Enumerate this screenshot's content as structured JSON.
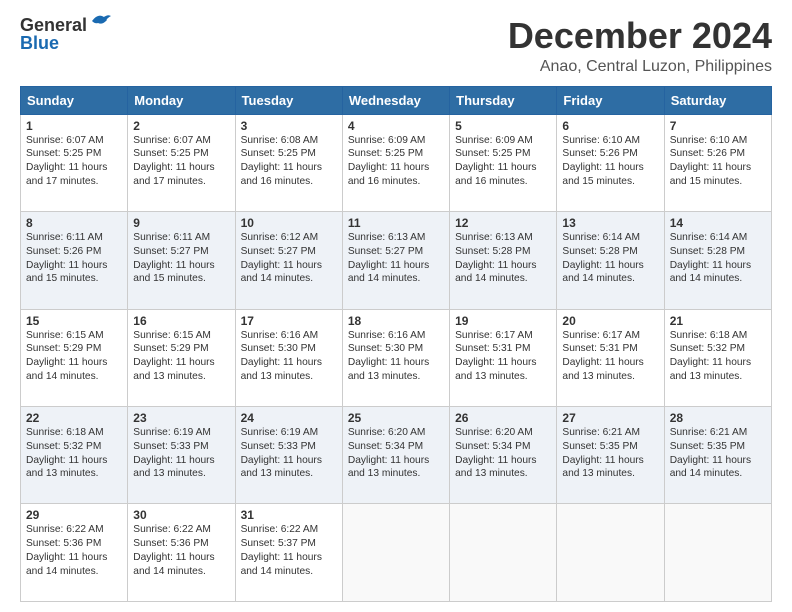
{
  "header": {
    "logo_general": "General",
    "logo_blue": "Blue",
    "title": "December 2024",
    "subtitle": "Anao, Central Luzon, Philippines"
  },
  "calendar": {
    "weekdays": [
      "Sunday",
      "Monday",
      "Tuesday",
      "Wednesday",
      "Thursday",
      "Friday",
      "Saturday"
    ],
    "weeks": [
      [
        null,
        null,
        null,
        null,
        {
          "day": 5,
          "sunrise": "6:09 AM",
          "sunset": "5:25 PM",
          "daylight": "11 hours and 16 minutes."
        },
        {
          "day": 6,
          "sunrise": "6:10 AM",
          "sunset": "5:26 PM",
          "daylight": "11 hours and 15 minutes."
        },
        {
          "day": 7,
          "sunrise": "6:10 AM",
          "sunset": "5:26 PM",
          "daylight": "11 hours and 15 minutes."
        }
      ],
      [
        {
          "day": 1,
          "sunrise": "6:07 AM",
          "sunset": "5:25 PM",
          "daylight": "11 hours and 17 minutes."
        },
        {
          "day": 2,
          "sunrise": "6:07 AM",
          "sunset": "5:25 PM",
          "daylight": "11 hours and 17 minutes."
        },
        {
          "day": 3,
          "sunrise": "6:08 AM",
          "sunset": "5:25 PM",
          "daylight": "11 hours and 16 minutes."
        },
        {
          "day": 4,
          "sunrise": "6:09 AM",
          "sunset": "5:25 PM",
          "daylight": "11 hours and 16 minutes."
        },
        {
          "day": 5,
          "sunrise": "6:09 AM",
          "sunset": "5:25 PM",
          "daylight": "11 hours and 16 minutes."
        },
        {
          "day": 6,
          "sunrise": "6:10 AM",
          "sunset": "5:26 PM",
          "daylight": "11 hours and 15 minutes."
        },
        {
          "day": 7,
          "sunrise": "6:10 AM",
          "sunset": "5:26 PM",
          "daylight": "11 hours and 15 minutes."
        }
      ],
      [
        {
          "day": 8,
          "sunrise": "6:11 AM",
          "sunset": "5:26 PM",
          "daylight": "11 hours and 15 minutes."
        },
        {
          "day": 9,
          "sunrise": "6:11 AM",
          "sunset": "5:27 PM",
          "daylight": "11 hours and 15 minutes."
        },
        {
          "day": 10,
          "sunrise": "6:12 AM",
          "sunset": "5:27 PM",
          "daylight": "11 hours and 14 minutes."
        },
        {
          "day": 11,
          "sunrise": "6:13 AM",
          "sunset": "5:27 PM",
          "daylight": "11 hours and 14 minutes."
        },
        {
          "day": 12,
          "sunrise": "6:13 AM",
          "sunset": "5:28 PM",
          "daylight": "11 hours and 14 minutes."
        },
        {
          "day": 13,
          "sunrise": "6:14 AM",
          "sunset": "5:28 PM",
          "daylight": "11 hours and 14 minutes."
        },
        {
          "day": 14,
          "sunrise": "6:14 AM",
          "sunset": "5:28 PM",
          "daylight": "11 hours and 14 minutes."
        }
      ],
      [
        {
          "day": 15,
          "sunrise": "6:15 AM",
          "sunset": "5:29 PM",
          "daylight": "11 hours and 14 minutes."
        },
        {
          "day": 16,
          "sunrise": "6:15 AM",
          "sunset": "5:29 PM",
          "daylight": "11 hours and 13 minutes."
        },
        {
          "day": 17,
          "sunrise": "6:16 AM",
          "sunset": "5:30 PM",
          "daylight": "11 hours and 13 minutes."
        },
        {
          "day": 18,
          "sunrise": "6:16 AM",
          "sunset": "5:30 PM",
          "daylight": "11 hours and 13 minutes."
        },
        {
          "day": 19,
          "sunrise": "6:17 AM",
          "sunset": "5:31 PM",
          "daylight": "11 hours and 13 minutes."
        },
        {
          "day": 20,
          "sunrise": "6:17 AM",
          "sunset": "5:31 PM",
          "daylight": "11 hours and 13 minutes."
        },
        {
          "day": 21,
          "sunrise": "6:18 AM",
          "sunset": "5:32 PM",
          "daylight": "11 hours and 13 minutes."
        }
      ],
      [
        {
          "day": 22,
          "sunrise": "6:18 AM",
          "sunset": "5:32 PM",
          "daylight": "11 hours and 13 minutes."
        },
        {
          "day": 23,
          "sunrise": "6:19 AM",
          "sunset": "5:33 PM",
          "daylight": "11 hours and 13 minutes."
        },
        {
          "day": 24,
          "sunrise": "6:19 AM",
          "sunset": "5:33 PM",
          "daylight": "11 hours and 13 minutes."
        },
        {
          "day": 25,
          "sunrise": "6:20 AM",
          "sunset": "5:34 PM",
          "daylight": "11 hours and 13 minutes."
        },
        {
          "day": 26,
          "sunrise": "6:20 AM",
          "sunset": "5:34 PM",
          "daylight": "11 hours and 13 minutes."
        },
        {
          "day": 27,
          "sunrise": "6:21 AM",
          "sunset": "5:35 PM",
          "daylight": "11 hours and 13 minutes."
        },
        {
          "day": 28,
          "sunrise": "6:21 AM",
          "sunset": "5:35 PM",
          "daylight": "11 hours and 14 minutes."
        }
      ],
      [
        {
          "day": 29,
          "sunrise": "6:22 AM",
          "sunset": "5:36 PM",
          "daylight": "11 hours and 14 minutes."
        },
        {
          "day": 30,
          "sunrise": "6:22 AM",
          "sunset": "5:36 PM",
          "daylight": "11 hours and 14 minutes."
        },
        {
          "day": 31,
          "sunrise": "6:22 AM",
          "sunset": "5:37 PM",
          "daylight": "11 hours and 14 minutes."
        },
        null,
        null,
        null,
        null
      ]
    ]
  },
  "labels": {
    "sunrise": "Sunrise:",
    "sunset": "Sunset:",
    "daylight": "Daylight:"
  }
}
